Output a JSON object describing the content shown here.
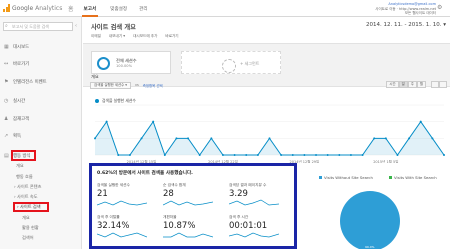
{
  "header": {
    "logo_brand": "Google",
    "logo_product": "Analytics",
    "nav": [
      "홈",
      "보고서",
      "맞춤설정",
      "관리"
    ],
    "account_email": "Analyticsdemo@gmail.com",
    "account_line2": "사이트로 이동 · http://www.realm.net",
    "account_line3": "모든 웹사이트 데이터"
  },
  "sidebar": {
    "search_placeholder": "보고서 및 도움말 검색",
    "items": [
      {
        "icon": "grid",
        "label": "대시보드"
      },
      {
        "icon": "link",
        "label": "바로가기"
      },
      {
        "icon": "flag",
        "label": "인텔리전스 이벤트"
      },
      {
        "icon": "clock",
        "label": "실시간"
      },
      {
        "icon": "person",
        "label": "잠재고객"
      },
      {
        "icon": "chart",
        "label": "획득"
      },
      {
        "icon": "doc",
        "label": "행동 방식"
      }
    ],
    "subitems": [
      "개요",
      "행동 흐름",
      "› 사이트 콘텐츠",
      "› 사이트 속도",
      "› 사이트 검색",
      "개요",
      "활용 현황",
      "검색어"
    ]
  },
  "main": {
    "page_title": "사이트 검색 개요",
    "date_range": "2014. 12. 11. - 2015. 1. 10.",
    "toolbar": [
      "이메일",
      "내보내기 ▾",
      "대시보드에 추가",
      "바로가기"
    ],
    "segment_label": "전체 세션수",
    "segment_sub": "100.00%",
    "add_segment": "+ 세그먼트",
    "overview_label": "개요",
    "metric_select": "검색을 실행한 세션수 ▾",
    "vs_label": "vs",
    "metric_select_link": "측정항목 선택",
    "intervals": [
      "시간",
      "일",
      "주",
      "월"
    ],
    "legend_series": "검색을 실행한 세션수",
    "chart_months": [
      "2014년 12월 15일",
      "2014년 12월 22일",
      "2014년 12월 29일",
      "2015년 1월 5일"
    ]
  },
  "summary": {
    "headline": "0.62%의 방문에서 사이트 검색을 사용했습니다.",
    "metrics": [
      {
        "label": "검색을 실행한 세션수",
        "value": "21"
      },
      {
        "label": "순 검색수 합계",
        "value": "28"
      },
      {
        "label": "검색당 결과 페이지뷰 수",
        "value": "3.29"
      },
      {
        "label": "검색 후 이탈률",
        "value": "32.14%"
      },
      {
        "label": "개편하율",
        "value": "10.87%"
      },
      {
        "label": "검색 후 시간",
        "value": "00:01:01"
      }
    ]
  },
  "pie_panel": {
    "legend": [
      "Visits Without Site Search",
      "Visits With Site Search"
    ],
    "pct_label": "99.4%",
    "colors": {
      "without": "#2e9ed6",
      "with": "#39b54a"
    }
  },
  "chart_data": {
    "type": "line",
    "series": [
      {
        "name": "검색을 실행한 세션수",
        "values": [
          1,
          2,
          0,
          0,
          1,
          2,
          0,
          1,
          1,
          0,
          1,
          0,
          0,
          0,
          0,
          1,
          0,
          0,
          0,
          0,
          0,
          0,
          0,
          0,
          1,
          1,
          0,
          1,
          2,
          1,
          0
        ]
      }
    ],
    "ylim": [
      0,
      3
    ],
    "grid": true
  },
  "colors": {
    "accent": "#058dc7",
    "highlight_red": "#e5131c",
    "highlight_blue": "#1a25a6"
  }
}
